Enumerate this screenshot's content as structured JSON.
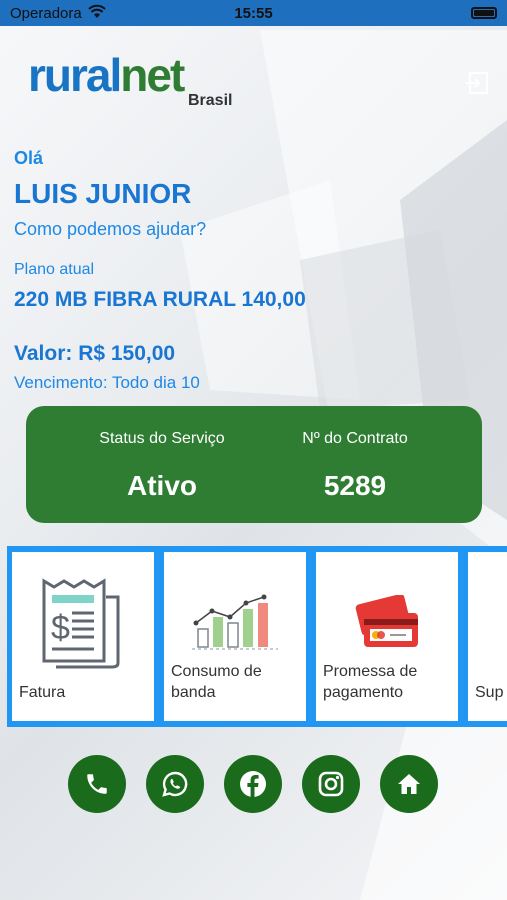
{
  "status_bar": {
    "carrier": "Operadora",
    "time": "15:55"
  },
  "logo": {
    "brand_part1": "rural",
    "brand_part2": "net",
    "sub": "Brasil"
  },
  "greeting": {
    "hello": "Olá",
    "name": "LUIS JUNIOR",
    "help": "Como podemos ajudar?"
  },
  "plan": {
    "label": "Plano atual",
    "name": "220 MB FIBRA RURAL 140,00",
    "value": "Valor: R$ 150,00",
    "due": "Vencimento: Todo dia 10"
  },
  "service": {
    "status_label": "Status do Serviço",
    "status_value": "Ativo",
    "contract_label": "Nº do Contrato",
    "contract_value": "5289"
  },
  "tiles": [
    {
      "label": "Fatura",
      "icon": "invoice-icon"
    },
    {
      "label": "Consumo de banda",
      "icon": "bandwidth-chart-icon"
    },
    {
      "label": "Promessa de pagamento",
      "icon": "credit-card-icon"
    },
    {
      "label": "Sup",
      "icon": "support-icon"
    }
  ],
  "social": [
    "phone-icon",
    "whatsapp-icon",
    "facebook-icon",
    "instagram-icon",
    "home-icon"
  ],
  "colors": {
    "blue": "#1976d2",
    "green": "#2e7d32",
    "tile_border": "#2196f3",
    "dark_green": "#1b6b1d"
  }
}
